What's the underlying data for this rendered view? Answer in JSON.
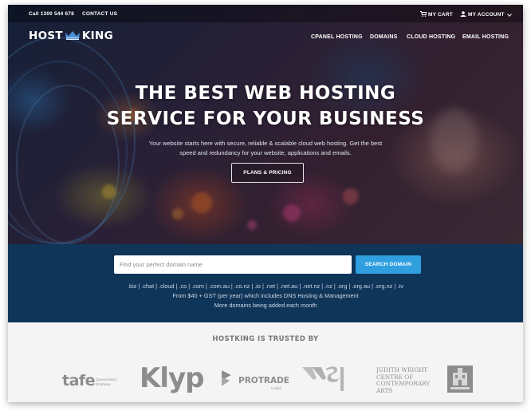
{
  "topbar": {
    "phone": "Call 1300 544 678",
    "contact": "CONTACT US",
    "cart": "MY CART",
    "account": "MY ACCOUNT"
  },
  "brand": {
    "left": "HOST",
    "right": "KING"
  },
  "nav": {
    "items": [
      "CPANEL HOSTING",
      "DOMAINS",
      "CLOUD HOSTING",
      "EMAIL HOSTING"
    ]
  },
  "hero": {
    "headline_1": "THE BEST WEB HOSTING",
    "headline_2": "SERVICE FOR YOUR BUSINESS",
    "sub_1": "Your website starts here with secure, reliable & scalable cloud web hosting. Get the best",
    "sub_2": "speed and redundancy for your website, applications and emails.",
    "cta": "PLANS & PRICING"
  },
  "domain_search": {
    "placeholder": "Find your perfect domain name",
    "button": "SEARCH DOMAIN",
    "tlds": ".biz | .chat | .cloud | .co | .com | .com.au | .co.nz | .io | .net | .net.au | .net.nz | .nz | .org | .org.au | .org.nz | .tv",
    "price_note": "From $40 + GST (per year) which includes DNS Hosting & Management",
    "more_note": "More domains being added each month"
  },
  "trusted": {
    "title": "HOSTKING IS TRUSTED BY",
    "logos": {
      "tafe": "tafe",
      "tafe_sub_1": "Queensland",
      "tafe_sub_2": "Brisbane",
      "klyp": "Klyp",
      "protrade": "PROTRADE",
      "protrade_sub": "United",
      "judith_1": "JUDITH WRIGHT",
      "judith_2": "CENTRE OF",
      "judith_3": "CONTEMPORARY",
      "judith_4": "ARTS"
    }
  },
  "colors": {
    "band_bg": "#0f3559",
    "search_button": "#2f9fe0",
    "crown_blue": "#4a8fd8",
    "logo_gray": "#8c8c8c"
  },
  "icons": [
    "cart-icon",
    "user-icon",
    "chevron-down-icon",
    "crown-icon"
  ]
}
